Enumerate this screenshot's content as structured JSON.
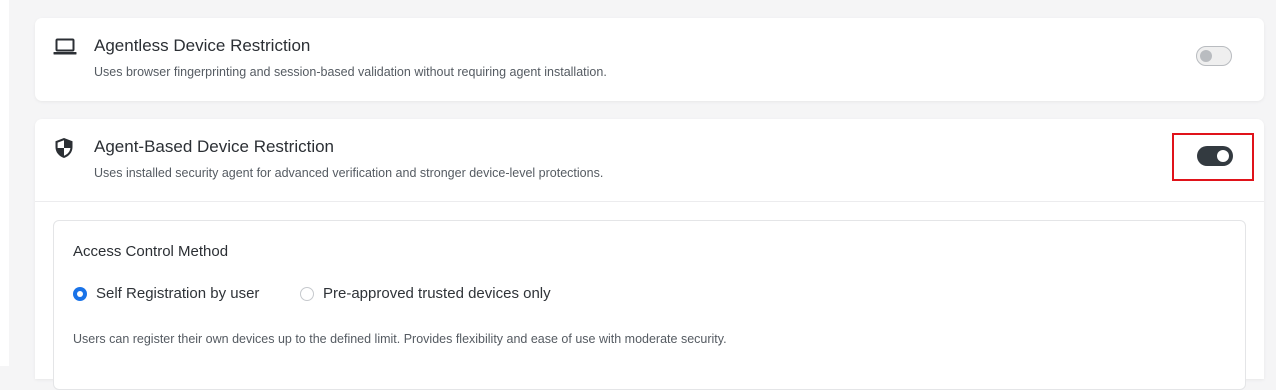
{
  "agentless": {
    "title": "Agentless Device Restriction",
    "description": "Uses browser fingerprinting and session-based validation without requiring agent installation.",
    "enabled": false,
    "icon": "laptop-icon"
  },
  "agent_based": {
    "title": "Agent-Based Device Restriction",
    "description": "Uses installed security agent for advanced verification and stronger device-level protections.",
    "enabled": true,
    "icon": "shield-icon",
    "access_control": {
      "label": "Access Control Method",
      "options": [
        {
          "label": "Self Registration by user",
          "selected": true
        },
        {
          "label": "Pre-approved trusted devices only",
          "selected": false
        }
      ],
      "help_text": "Users can register their own devices up to the defined limit. Provides flexibility and ease of use with moderate security."
    }
  },
  "colors": {
    "accent": "#1a73e8",
    "toggle_on": "#333a40",
    "highlight": "#e0131a"
  }
}
